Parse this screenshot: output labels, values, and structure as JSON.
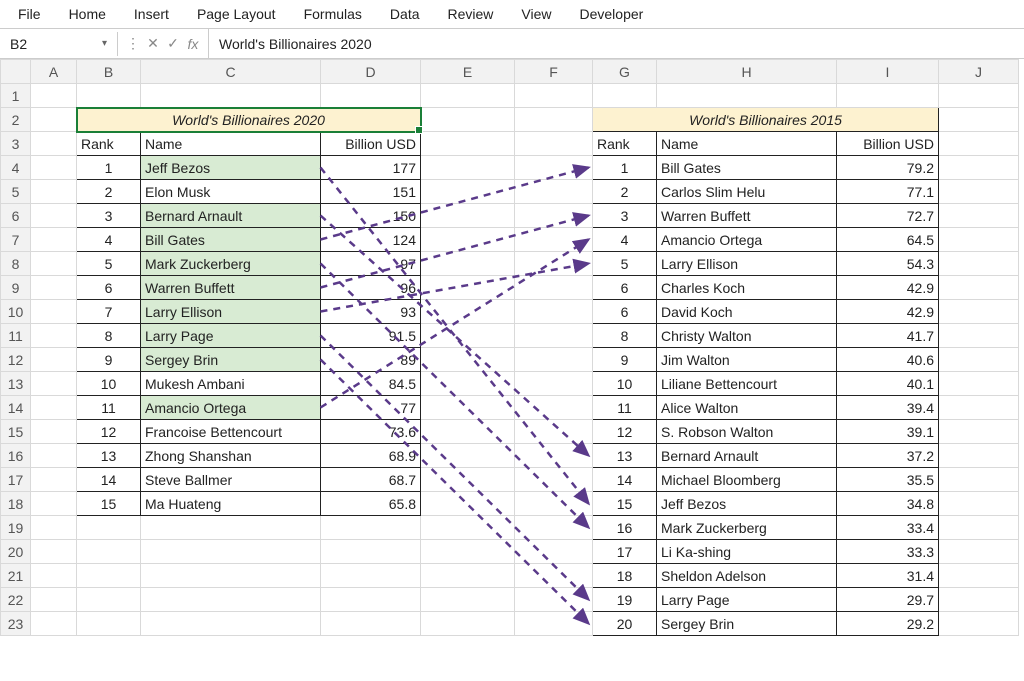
{
  "ribbon": {
    "items": [
      "File",
      "Home",
      "Insert",
      "Page Layout",
      "Formulas",
      "Data",
      "Review",
      "View",
      "Developer"
    ]
  },
  "formula_bar": {
    "name_box": "B2",
    "formula_value": "World's Billionaires 2020"
  },
  "columns": [
    "A",
    "B",
    "C",
    "D",
    "E",
    "F",
    "G",
    "H",
    "I",
    "J"
  ],
  "row_count": 23,
  "table2020": {
    "title": "World's Billionaires 2020",
    "headers": {
      "rank": "Rank",
      "name": "Name",
      "usd": "Billion USD"
    },
    "rows": [
      {
        "rank": 1,
        "name": "Jeff Bezos",
        "usd": "177",
        "hl": true
      },
      {
        "rank": 2,
        "name": "Elon Musk",
        "usd": "151",
        "hl": false
      },
      {
        "rank": 3,
        "name": "Bernard Arnault",
        "usd": "150",
        "hl": true
      },
      {
        "rank": 4,
        "name": "Bill Gates",
        "usd": "124",
        "hl": true
      },
      {
        "rank": 5,
        "name": "Mark Zuckerberg",
        "usd": "97",
        "hl": true
      },
      {
        "rank": 6,
        "name": "Warren Buffett",
        "usd": "96",
        "hl": true
      },
      {
        "rank": 7,
        "name": "Larry Ellison",
        "usd": "93",
        "hl": true
      },
      {
        "rank": 8,
        "name": "Larry Page",
        "usd": "91.5",
        "hl": true
      },
      {
        "rank": 9,
        "name": "Sergey Brin",
        "usd": "89",
        "hl": true
      },
      {
        "rank": 10,
        "name": "Mukesh Ambani",
        "usd": "84.5",
        "hl": false
      },
      {
        "rank": 11,
        "name": "Amancio Ortega",
        "usd": "77",
        "hl": true
      },
      {
        "rank": 12,
        "name": "Francoise Bettencourt",
        "usd": "73.6",
        "hl": false
      },
      {
        "rank": 13,
        "name": "Zhong Shanshan",
        "usd": "68.9",
        "hl": false
      },
      {
        "rank": 14,
        "name": "Steve Ballmer",
        "usd": "68.7",
        "hl": false
      },
      {
        "rank": 15,
        "name": "Ma Huateng",
        "usd": "65.8",
        "hl": false
      }
    ]
  },
  "table2015": {
    "title": "World's Billionaires 2015",
    "headers": {
      "rank": "Rank",
      "name": "Name",
      "usd": "Billion USD"
    },
    "rows": [
      {
        "rank": 1,
        "name": "Bill Gates",
        "usd": "79.2"
      },
      {
        "rank": 2,
        "name": "Carlos Slim Helu",
        "usd": "77.1"
      },
      {
        "rank": 3,
        "name": "Warren Buffett",
        "usd": "72.7"
      },
      {
        "rank": 4,
        "name": "Amancio Ortega",
        "usd": "64.5"
      },
      {
        "rank": 5,
        "name": "Larry Ellison",
        "usd": "54.3"
      },
      {
        "rank": 6,
        "name": "Charles Koch",
        "usd": "42.9"
      },
      {
        "rank": 6,
        "name": "David Koch",
        "usd": "42.9"
      },
      {
        "rank": 8,
        "name": "Christy Walton",
        "usd": "41.7"
      },
      {
        "rank": 9,
        "name": "Jim Walton",
        "usd": "40.6"
      },
      {
        "rank": 10,
        "name": "Liliane Bettencourt",
        "usd": "40.1"
      },
      {
        "rank": 11,
        "name": "Alice Walton",
        "usd": "39.4"
      },
      {
        "rank": 12,
        "name": "S. Robson Walton",
        "usd": "39.1"
      },
      {
        "rank": 13,
        "name": "Bernard Arnault",
        "usd": "37.2"
      },
      {
        "rank": 14,
        "name": "Michael Bloomberg",
        "usd": "35.5"
      },
      {
        "rank": 15,
        "name": "Jeff Bezos",
        "usd": "34.8"
      },
      {
        "rank": 16,
        "name": "Mark Zuckerberg",
        "usd": "33.4"
      },
      {
        "rank": 17,
        "name": "Li Ka-shing",
        "usd": "33.3"
      },
      {
        "rank": 18,
        "name": "Sheldon Adelson",
        "usd": "31.4"
      },
      {
        "rank": 19,
        "name": "Larry Page",
        "usd": "29.7"
      },
      {
        "rank": 20,
        "name": "Sergey Brin",
        "usd": "29.2"
      }
    ]
  },
  "arrows": [
    {
      "from_left_row": 0,
      "to_right_row": 14
    },
    {
      "from_left_row": 2,
      "to_right_row": 12
    },
    {
      "from_left_row": 3,
      "to_right_row": 0
    },
    {
      "from_left_row": 4,
      "to_right_row": 15
    },
    {
      "from_left_row": 5,
      "to_right_row": 2
    },
    {
      "from_left_row": 6,
      "to_right_row": 4
    },
    {
      "from_left_row": 7,
      "to_right_row": 18
    },
    {
      "from_left_row": 8,
      "to_right_row": 19
    },
    {
      "from_left_row": 10,
      "to_right_row": 3
    }
  ],
  "chart_data": [
    {
      "type": "table",
      "title": "World's Billionaires 2020",
      "columns": [
        "Rank",
        "Name",
        "Billion USD"
      ],
      "rows": [
        [
          1,
          "Jeff Bezos",
          177
        ],
        [
          2,
          "Elon Musk",
          151
        ],
        [
          3,
          "Bernard Arnault",
          150
        ],
        [
          4,
          "Bill Gates",
          124
        ],
        [
          5,
          "Mark Zuckerberg",
          97
        ],
        [
          6,
          "Warren Buffett",
          96
        ],
        [
          7,
          "Larry Ellison",
          93
        ],
        [
          8,
          "Larry Page",
          91.5
        ],
        [
          9,
          "Sergey Brin",
          89
        ],
        [
          10,
          "Mukesh Ambani",
          84.5
        ],
        [
          11,
          "Amancio Ortega",
          77
        ],
        [
          12,
          "Francoise Bettencourt",
          73.6
        ],
        [
          13,
          "Zhong Shanshan",
          68.9
        ],
        [
          14,
          "Steve Ballmer",
          68.7
        ],
        [
          15,
          "Ma Huateng",
          65.8
        ]
      ]
    },
    {
      "type": "table",
      "title": "World's Billionaires 2015",
      "columns": [
        "Rank",
        "Name",
        "Billion USD"
      ],
      "rows": [
        [
          1,
          "Bill Gates",
          79.2
        ],
        [
          2,
          "Carlos Slim Helu",
          77.1
        ],
        [
          3,
          "Warren Buffett",
          72.7
        ],
        [
          4,
          "Amancio Ortega",
          64.5
        ],
        [
          5,
          "Larry Ellison",
          54.3
        ],
        [
          6,
          "Charles Koch",
          42.9
        ],
        [
          6,
          "David Koch",
          42.9
        ],
        [
          8,
          "Christy Walton",
          41.7
        ],
        [
          9,
          "Jim Walton",
          40.6
        ],
        [
          10,
          "Liliane Bettencourt",
          40.1
        ],
        [
          11,
          "Alice Walton",
          39.4
        ],
        [
          12,
          "S. Robson Walton",
          39.1
        ],
        [
          13,
          "Bernard Arnault",
          37.2
        ],
        [
          14,
          "Michael Bloomberg",
          35.5
        ],
        [
          15,
          "Jeff Bezos",
          34.8
        ],
        [
          16,
          "Mark Zuckerberg",
          33.4
        ],
        [
          17,
          "Li Ka-shing",
          33.3
        ],
        [
          18,
          "Sheldon Adelson",
          31.4
        ],
        [
          19,
          "Larry Page",
          29.7
        ],
        [
          20,
          "Sergey Brin",
          29.2
        ]
      ]
    }
  ]
}
